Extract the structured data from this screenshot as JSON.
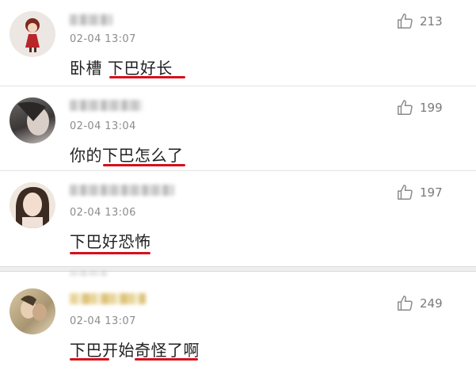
{
  "comments": [
    {
      "time": "02-04 13:07",
      "text": "卧槽 下巴好长",
      "likes": "213"
    },
    {
      "time": "02-04 13:04",
      "text": "你的下巴怎么了",
      "likes": "199"
    },
    {
      "time": "02-04 13:06",
      "text": "下巴好恐怖",
      "likes": "197"
    },
    {
      "time": "02-04 13:07",
      "text": "下巴开始奇怪了啊",
      "likes": "249"
    }
  ],
  "colors": {
    "underline": "#d6101c",
    "time": "#8c8c8c",
    "likes": "#7a7a7a"
  },
  "icons": {
    "like": "thumbs-up-icon"
  }
}
